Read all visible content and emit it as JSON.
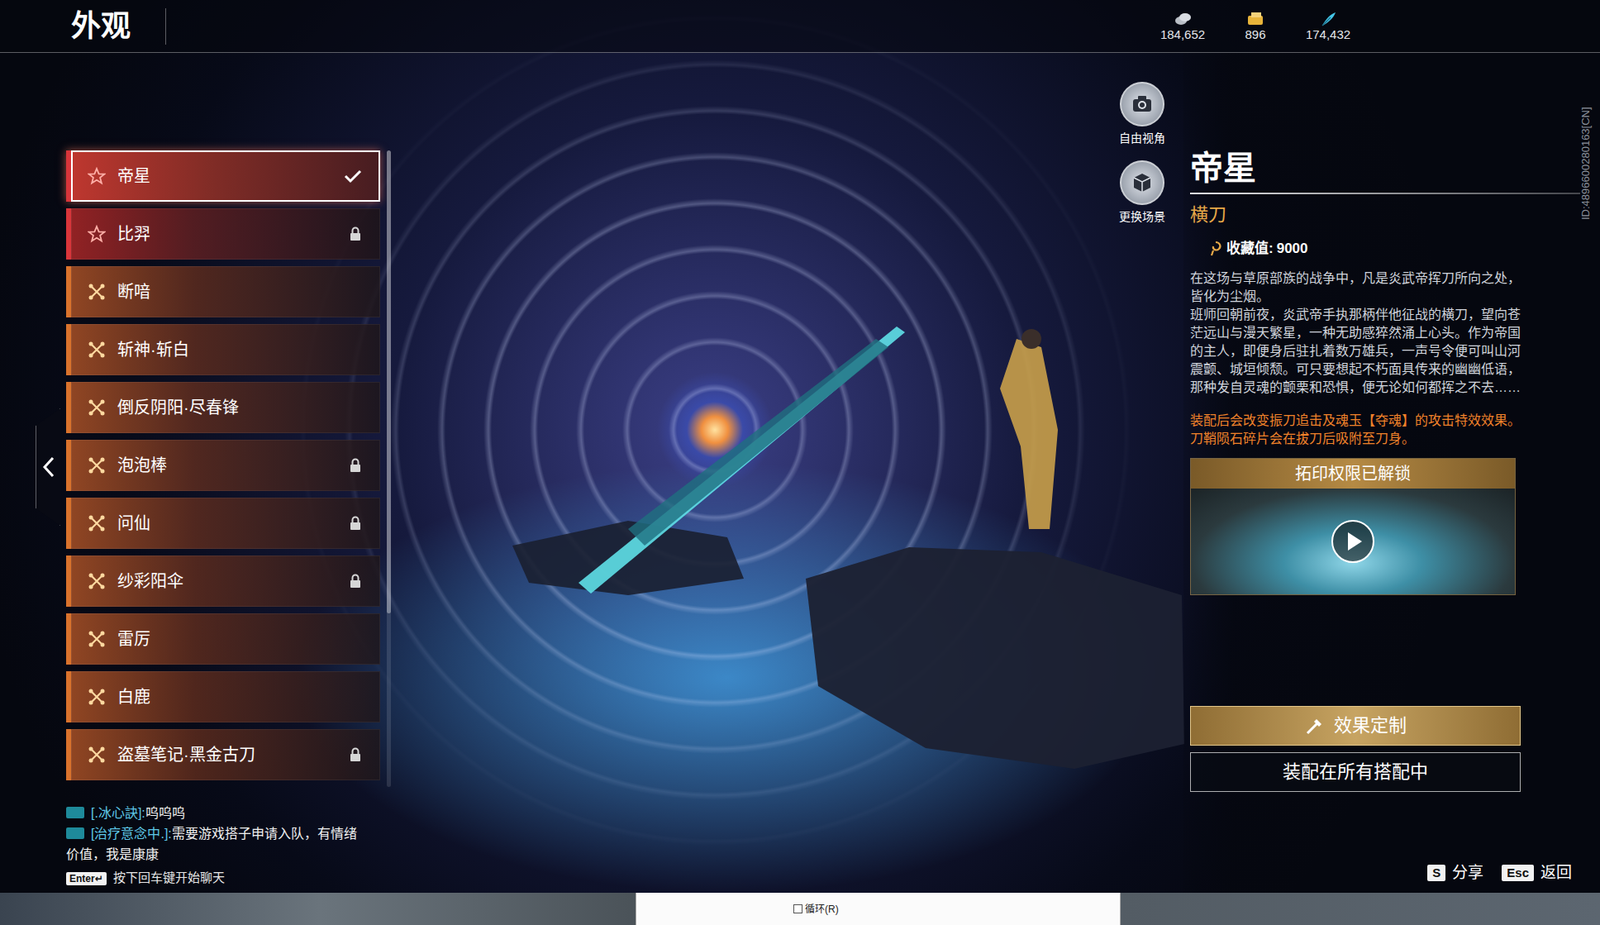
{
  "page": {
    "title": "外观",
    "player_id": "ID:4896600280163[CN]"
  },
  "currencies": [
    {
      "value": "184,652"
    },
    {
      "value": "896"
    },
    {
      "value": "174,432"
    }
  ],
  "skins": [
    {
      "name": "帝星",
      "kind": "legend",
      "selected": true,
      "locked": false
    },
    {
      "name": "比羿",
      "kind": "legend",
      "selected": false,
      "locked": true
    },
    {
      "name": "断喑",
      "kind": "epic",
      "selected": false,
      "locked": false
    },
    {
      "name": "斩神·斩白",
      "kind": "epic",
      "selected": false,
      "locked": false
    },
    {
      "name": "倒反阴阳·尽春锋",
      "kind": "epic",
      "selected": false,
      "locked": false
    },
    {
      "name": "泡泡棒",
      "kind": "epic",
      "selected": false,
      "locked": true
    },
    {
      "name": "问仙",
      "kind": "epic",
      "selected": false,
      "locked": true
    },
    {
      "name": "纱彩阳伞",
      "kind": "epic",
      "selected": false,
      "locked": true
    },
    {
      "name": "雷厉",
      "kind": "epic",
      "selected": false,
      "locked": false
    },
    {
      "name": "白鹿",
      "kind": "epic",
      "selected": false,
      "locked": false
    },
    {
      "name": "盗墓笔记·黑金古刀",
      "kind": "epic",
      "selected": false,
      "locked": true
    }
  ],
  "view_tools": [
    {
      "label": "自由视角"
    },
    {
      "label": "更换场景"
    }
  ],
  "detail": {
    "name": "帝星",
    "weapon_type": "横刀",
    "collection_label": "收藏值:",
    "collection_value": "9000",
    "description": [
      "在这场与草原部族的战争中，凡是炎武帝挥刀所向之处，皆化为尘烟。",
      "班师回朝前夜，炎武帝手执那柄伴他征战的横刀，望向苍茫远山与漫天繁星，一种无助感猝然涌上心头。作为帝国的主人，即便身后驻扎着数万雄兵，一声号令便可叫山河震颤、城垣倾颓。可只要想起不朽面具传来的幽幽低语，那种发自灵魂的颤栗和恐惧，便无论如何都挥之不去……"
    ],
    "effects": [
      "装配后会改变振刀追击及魂玉【夺魂】的攻击特效效果。",
      "刀鞘陨石碎片会在拔刀后吸附至刀身。"
    ],
    "video_title": "拓印权限已解锁"
  },
  "buttons": [
    {
      "label": "效果定制",
      "kind": "gold"
    },
    {
      "label": "装配在所有搭配中",
      "kind": "line"
    }
  ],
  "chat": {
    "messages": [
      {
        "channel": "[.冰心訣]:",
        "text": "呜呜呜"
      },
      {
        "channel": "[治疗意念中.]:",
        "text": "需要游戏搭子申请入队，有情绪价值，我是康康"
      }
    ],
    "key": "Enter↵",
    "hint": "按下回车键开始聊天"
  },
  "shortcuts": [
    {
      "key": "S",
      "label": "分享"
    },
    {
      "key": "Esc",
      "label": "返回"
    }
  ],
  "taskbar": {
    "loop_label": "循环(R)",
    "loop_checked": false
  }
}
